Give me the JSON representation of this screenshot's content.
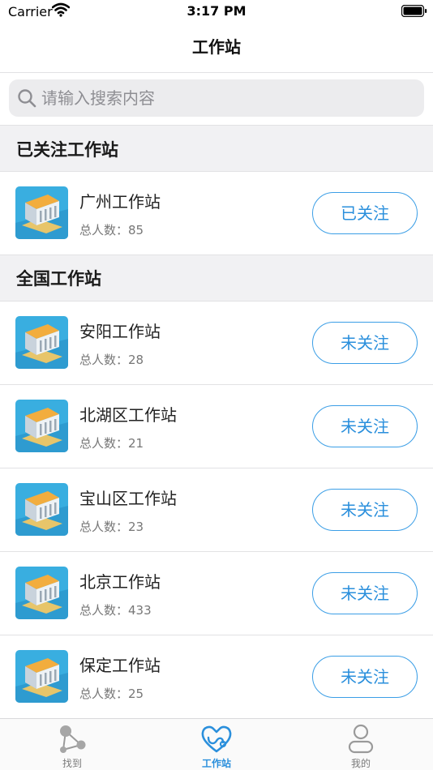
{
  "status_bar": {
    "carrier": "Carrier",
    "time": "3:17 PM",
    "icons": [
      "wifi-icon",
      "battery-icon"
    ]
  },
  "nav": {
    "title": "工作站"
  },
  "search": {
    "placeholder": "请输入搜索内容",
    "icon": "search-icon"
  },
  "followed_section": {
    "title": "已关注工作站",
    "items": [
      {
        "name": "广州工作站",
        "count_label": "总人数：85",
        "button": "已关注"
      }
    ]
  },
  "national_section": {
    "title": "全国工作站",
    "items": [
      {
        "name": "安阳工作站",
        "count_label": "总人数：28",
        "button": "未关注"
      },
      {
        "name": "北湖区工作站",
        "count_label": "总人数：21",
        "button": "未关注"
      },
      {
        "name": "宝山区工作站",
        "count_label": "总人数：23",
        "button": "未关注"
      },
      {
        "name": "北京工作站",
        "count_label": "总人数：433",
        "button": "未关注"
      },
      {
        "name": "保定工作站",
        "count_label": "总人数：25",
        "button": "未关注"
      }
    ]
  },
  "tabs": [
    {
      "label": "找到",
      "icon": "molecule-icon",
      "active": false
    },
    {
      "label": "工作站",
      "icon": "heart-stethoscope-icon",
      "active": true
    },
    {
      "label": "我的",
      "icon": "person-icon",
      "active": false
    }
  ],
  "colors": {
    "accent": "#2a8fdc",
    "section_bg": "#f1f1f3",
    "search_bg": "#ececee"
  }
}
